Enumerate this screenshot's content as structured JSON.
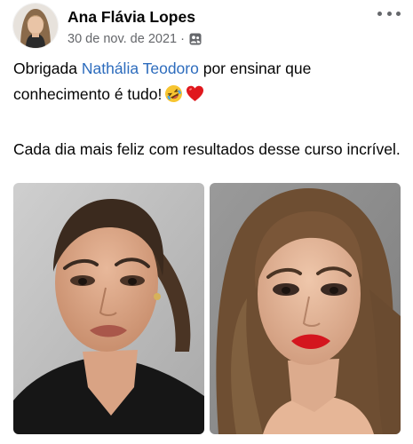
{
  "post": {
    "author": "Ana Flávia Lopes",
    "date": "30 de nov. de 2021",
    "separator": "·",
    "audience_icon": "friends-icon",
    "more_icon": "more-options-icon",
    "text": {
      "line1_before": "Obrigada ",
      "mention": "Nathália Teodoro",
      "line1_after": " por ensinar que conhecimento é tudo!",
      "emoji_1": "rolling-on-floor-laughing-emoji",
      "emoji_2": "red-heart-emoji",
      "paragraph_2": "Cada dia mais feliz com resultados desse curso incrível."
    },
    "photos": [
      {
        "subject": "woman-ponytail-dark-blazer-nude-lips"
      },
      {
        "subject": "woman-long-hair-red-lips"
      }
    ]
  },
  "colors": {
    "name_text": "#050505",
    "meta_text": "#65676b",
    "mention": "#2d6cbd",
    "background": "#ffffff"
  }
}
